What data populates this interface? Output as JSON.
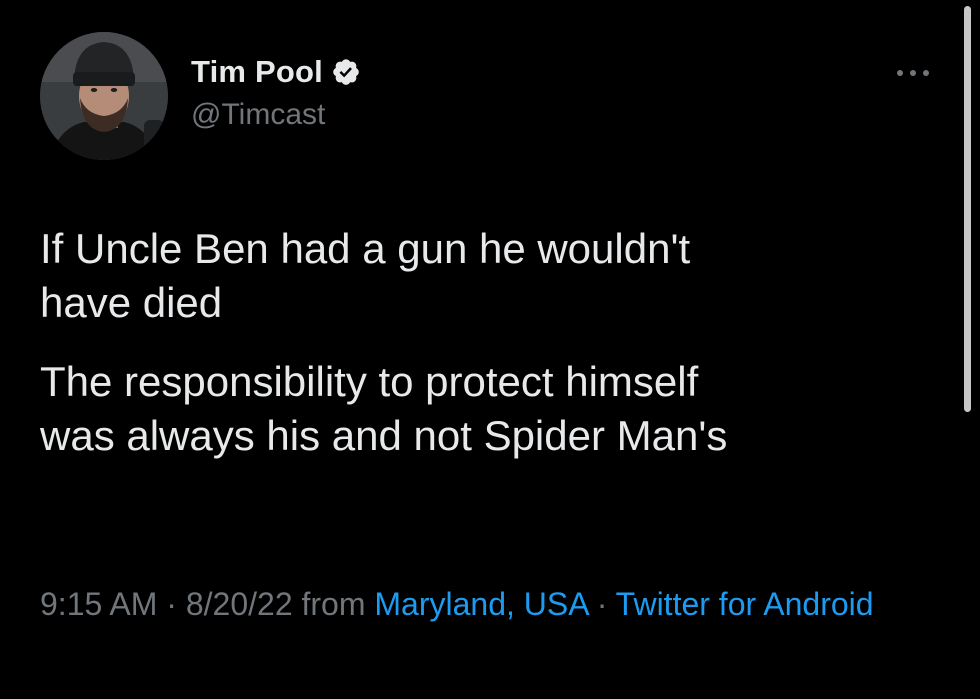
{
  "author": {
    "display_name": "Tim Pool",
    "handle": "@Timcast",
    "verified": true
  },
  "tweet": {
    "paragraph_1": "If Uncle Ben had a gun he wouldn't\nhave died",
    "paragraph_2": "The responsibility to protect himself\nwas always his and not Spider Man's"
  },
  "meta": {
    "time": "9:15 AM",
    "separator_1": " · ",
    "date": "8/20/22",
    "from_text": " from ",
    "location": "Maryland, USA",
    "separator_2": " · ",
    "client": "Twitter for Android"
  },
  "icons": {
    "more": "more-horizontal-icon",
    "verified": "verified-badge-icon"
  },
  "colors": {
    "background": "#000000",
    "primary_text": "#e7e9ea",
    "secondary_text": "#71767b",
    "link": "#1d9bf0",
    "verified_badge": "#e7e9ea"
  }
}
